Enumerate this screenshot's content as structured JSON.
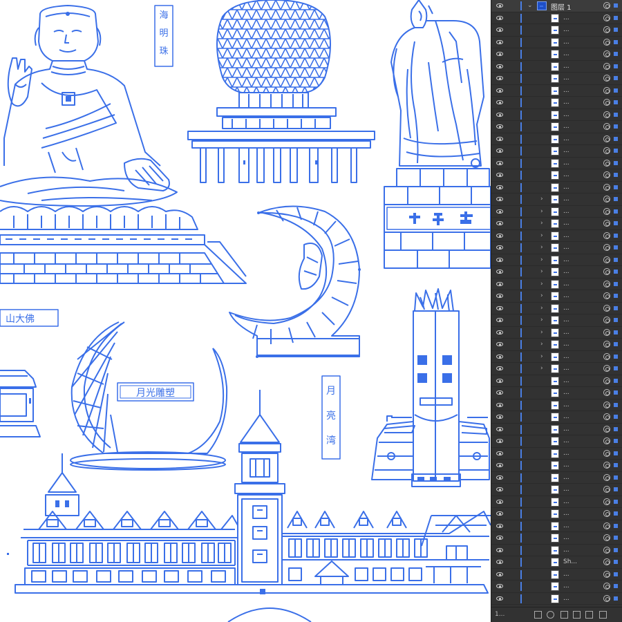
{
  "colors": {
    "artwork_stroke": "#3a6fe8",
    "panel_bg": "#323232",
    "selection": "#4a7fe5"
  },
  "artwork": {
    "label_haimingzhu": [
      "海",
      "明",
      "珠"
    ],
    "label_moon_sculpture": "月光雕塑",
    "label_moon_bay": [
      "月",
      "亮",
      "湾"
    ],
    "label_big_buddha": "山大佛"
  },
  "layers_panel": {
    "top_layer_name": "图层 1",
    "sublayer_names": [
      "...",
      "...",
      "...",
      "...",
      "...",
      "...",
      "...",
      "...",
      "...",
      "...",
      "...",
      "...",
      "...",
      "...",
      "...",
      "...",
      "...",
      "...",
      "...",
      "...",
      "...",
      "...",
      "...",
      "...",
      "...",
      "...",
      "...",
      "...",
      "...",
      "...",
      "...",
      "...",
      "...",
      "...",
      "...",
      "...",
      "...",
      "...",
      "...",
      "...",
      "...",
      "...",
      "...",
      "...",
      "...",
      "Sh...",
      "...",
      "...",
      "..."
    ],
    "expandable_rows": [
      15,
      16,
      17,
      18,
      19,
      20,
      21,
      22,
      23,
      24,
      25,
      26,
      27,
      28,
      29
    ],
    "footer_count": "1..."
  }
}
